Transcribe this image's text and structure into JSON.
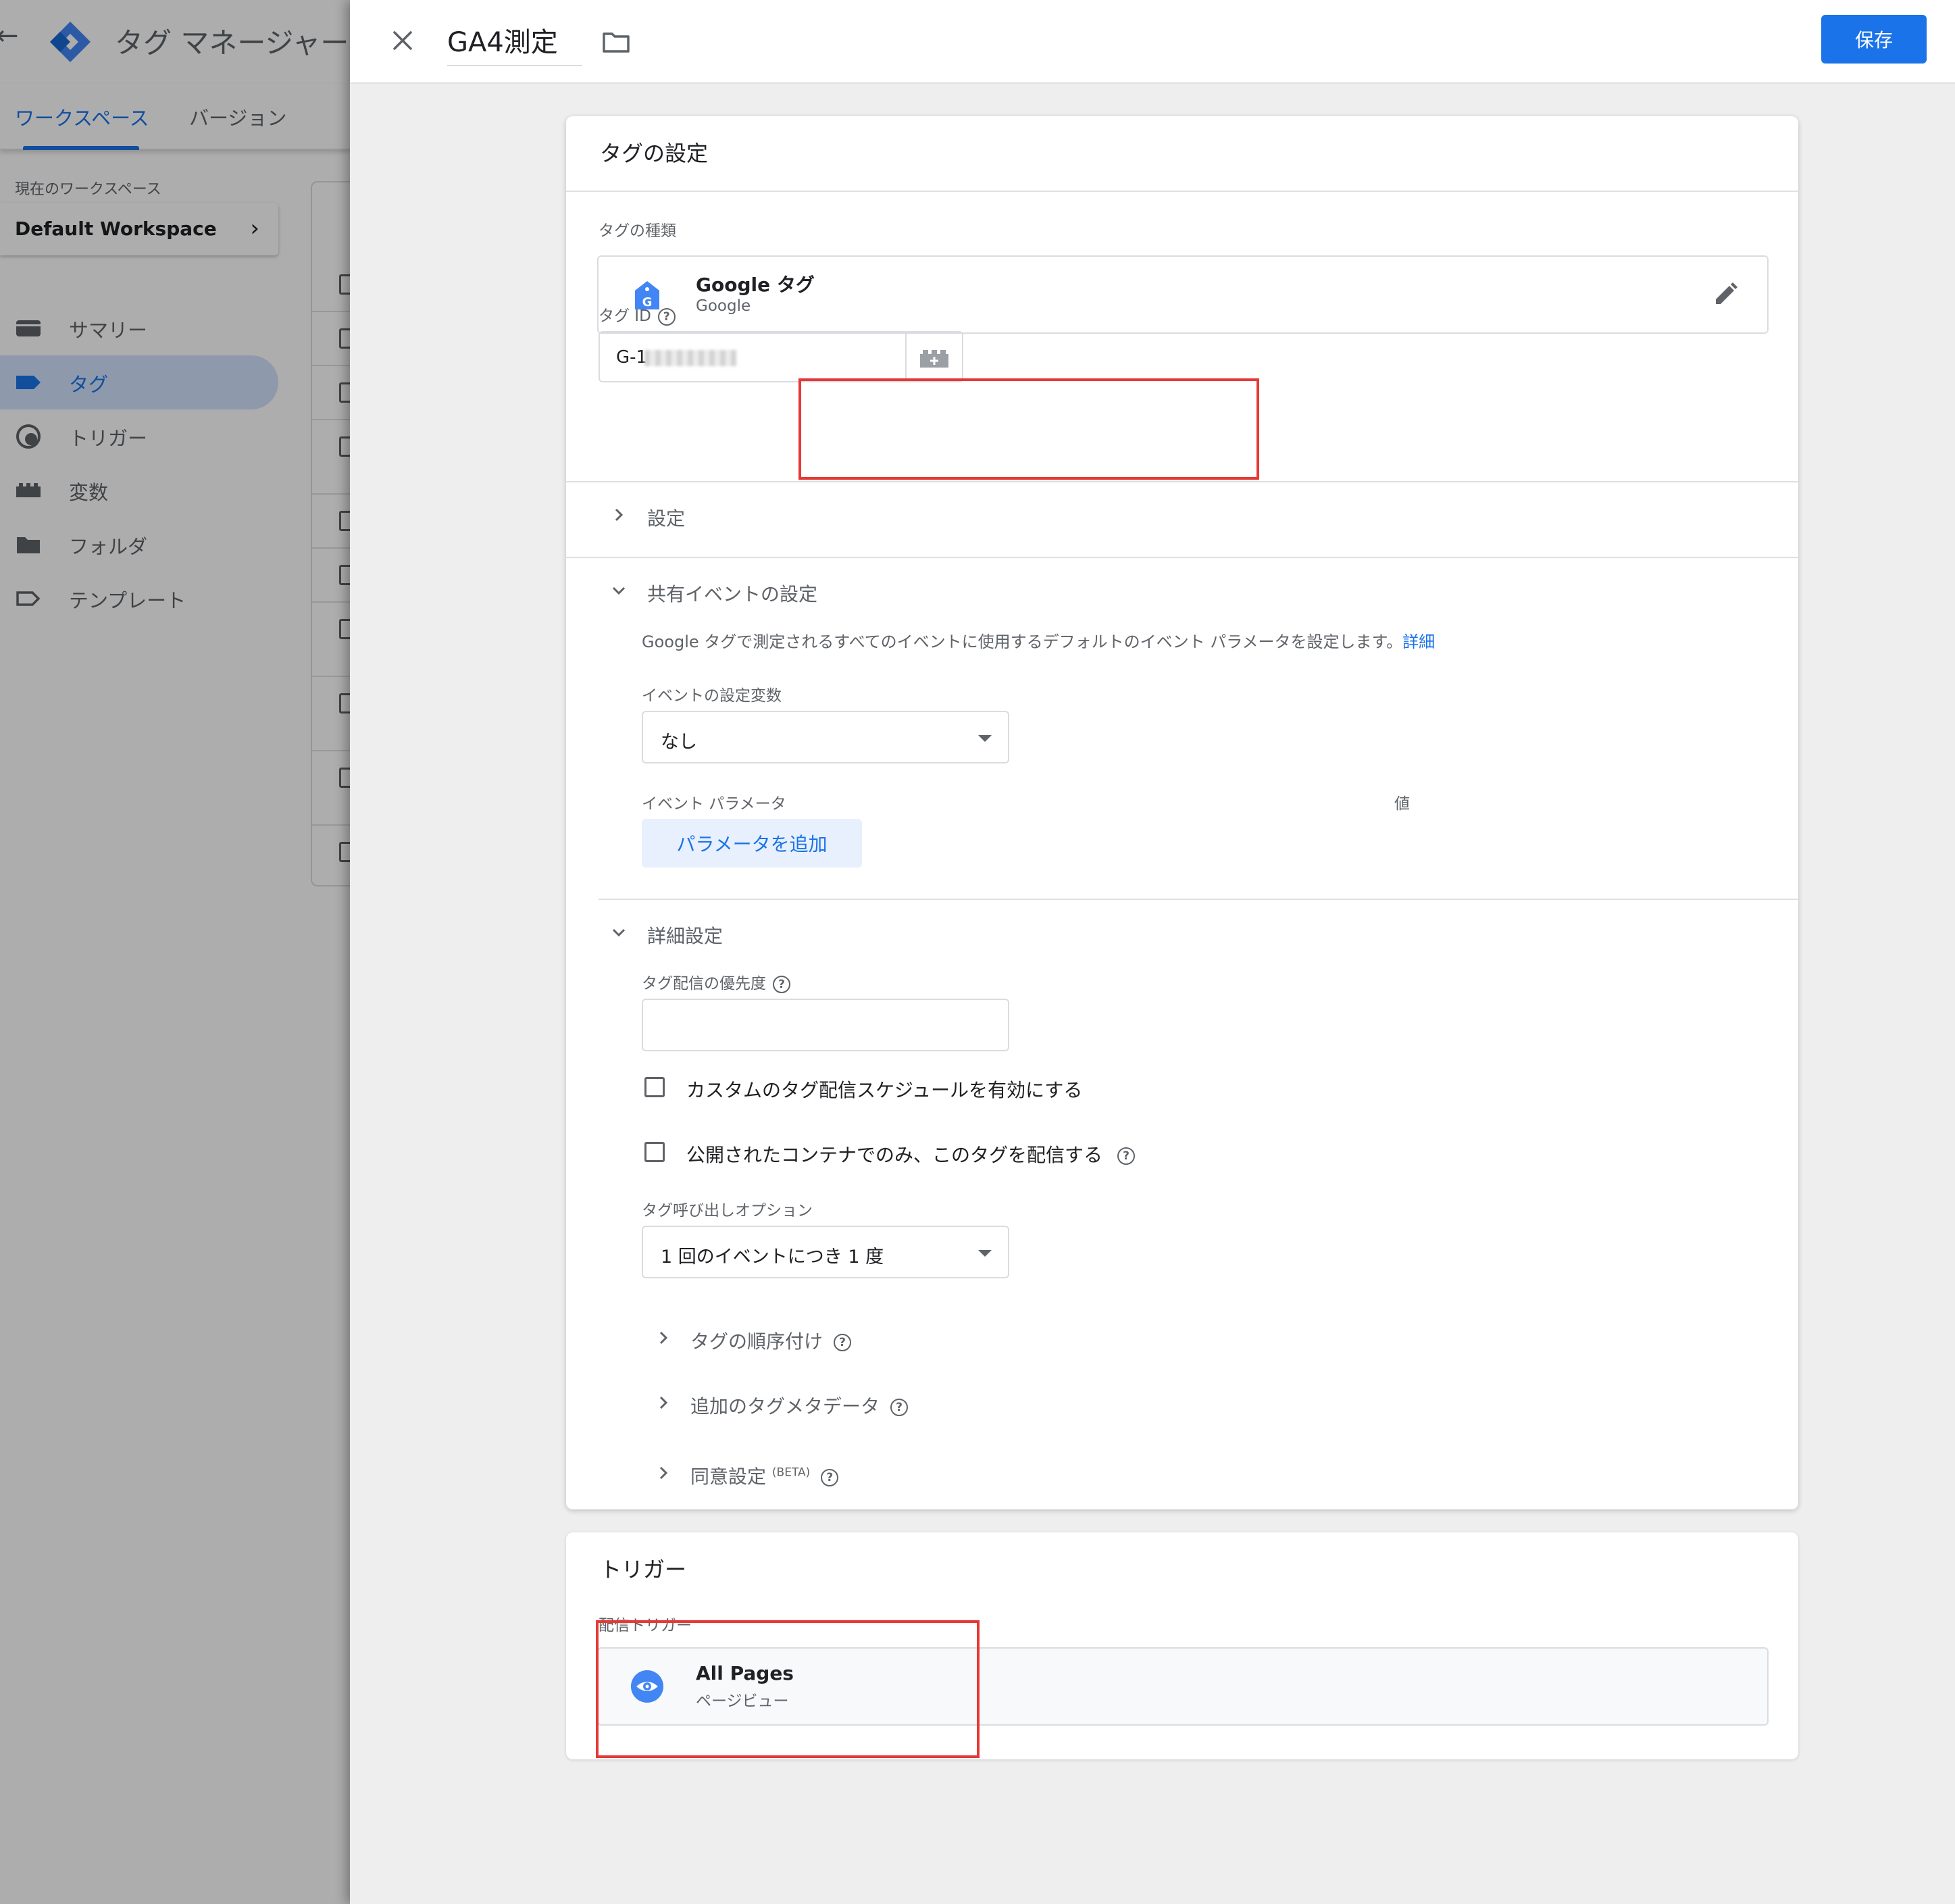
{
  "sidebar": {
    "title": "タグ マネージャー",
    "tabs": [
      {
        "label": "ワークスペース",
        "active": true
      },
      {
        "label": "バージョン",
        "active": false
      }
    ],
    "workspace_label": "現在のワークスペース",
    "workspace_name": "Default Workspace",
    "nav": [
      {
        "label": "サマリー",
        "icon": "summary-icon"
      },
      {
        "label": "タグ",
        "icon": "tag-icon",
        "active": true
      },
      {
        "label": "トリガー",
        "icon": "trigger-icon"
      },
      {
        "label": "変数",
        "icon": "variables-icon"
      },
      {
        "label": "フォルダ",
        "icon": "folder-icon"
      },
      {
        "label": "テンプレート",
        "icon": "template-icon"
      }
    ]
  },
  "header": {
    "tag_name": "GA4測定",
    "save_label": "保存"
  },
  "tag_config": {
    "title": "タグの設定",
    "tag_type_label": "タグの種類",
    "tag_type_name": "Google タグ",
    "tag_type_vendor": "Google",
    "tag_id_label": "タグ ID",
    "tag_id_value": "G-1",
    "settings_label": "設定",
    "shared_event": {
      "label": "共有イベントの設定",
      "description": "Google タグで測定されるすべてのイベントに使用するデフォルトのイベント パラメータを設定します。",
      "details_link": "詳細",
      "event_settings_var_label": "イベントの設定変数",
      "event_settings_var_value": "なし",
      "event_params_label": "イベント パラメータ",
      "value_label": "値",
      "add_param_label": "パラメータを追加"
    },
    "advanced": {
      "label": "詳細設定",
      "priority_label": "タグ配信の優先度",
      "priority_value": "",
      "custom_schedule_label": "カスタムのタグ配信スケジュールを有効にする",
      "published_only_label": "公開されたコンテナでのみ、このタグを配信する",
      "firing_option_label": "タグ呼び出しオプション",
      "firing_option_value": "1 回のイベントにつき 1 度",
      "tag_sequencing_label": "タグの順序付け",
      "additional_metadata_label": "追加のタグメタデータ",
      "consent_label": "同意設定",
      "consent_badge": "(BETA)"
    }
  },
  "triggering": {
    "title": "トリガー",
    "firing_triggers_label": "配信トリガー",
    "trigger_name": "All Pages",
    "trigger_type": "ページビュー"
  },
  "colors": {
    "accent": "#1a73e8",
    "highlight_box": "#e53935"
  }
}
